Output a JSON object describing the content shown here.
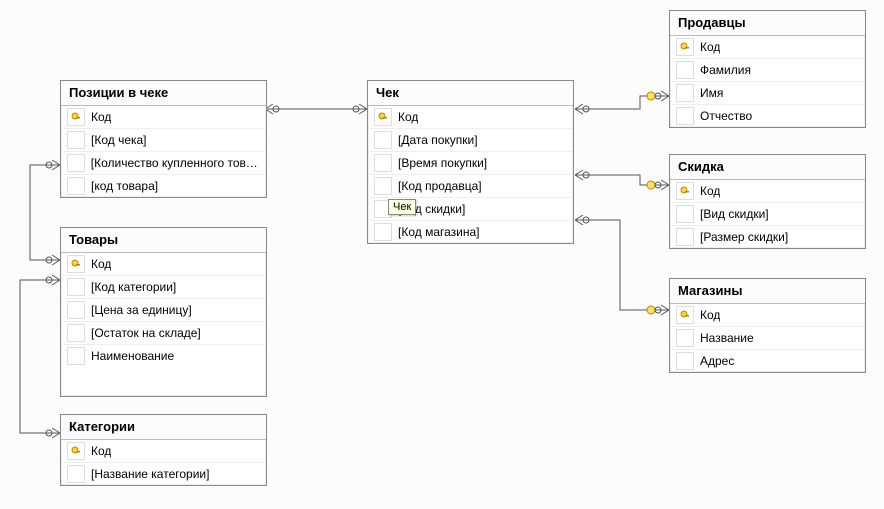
{
  "diagram_type": "database-relationship-diagram",
  "tables": {
    "positions": {
      "title": "Позиции в чеке",
      "fields": [
        {
          "name": "Код",
          "key": true
        },
        {
          "name": "[Код чека]",
          "key": false
        },
        {
          "name": "[Количество купленного това...",
          "key": false
        },
        {
          "name": "[код товара]",
          "key": false
        }
      ]
    },
    "check": {
      "title": "Чек",
      "fields": [
        {
          "name": "Код",
          "key": true
        },
        {
          "name": "[Дата покупки]",
          "key": false
        },
        {
          "name": "[Время покупки]",
          "key": false
        },
        {
          "name": "[Код продавца]",
          "key": false
        },
        {
          "name": "[Код скидки]",
          "key": false
        },
        {
          "name": "[Код магазина]",
          "key": false
        }
      ]
    },
    "goods": {
      "title": "Товары",
      "fields": [
        {
          "name": "Код",
          "key": true
        },
        {
          "name": "[Код категории]",
          "key": false
        },
        {
          "name": "[Цена за единицу]",
          "key": false
        },
        {
          "name": "[Остаток на складе]",
          "key": false
        },
        {
          "name": "Наименование",
          "key": false
        }
      ]
    },
    "categories": {
      "title": "Категории",
      "fields": [
        {
          "name": "Код",
          "key": true
        },
        {
          "name": "[Название категории]",
          "key": false
        }
      ]
    },
    "sellers": {
      "title": "Продавцы",
      "fields": [
        {
          "name": "Код",
          "key": true
        },
        {
          "name": "Фамилия",
          "key": false
        },
        {
          "name": "Имя",
          "key": false
        },
        {
          "name": "Отчество",
          "key": false
        }
      ]
    },
    "discount": {
      "title": "Скидка",
      "fields": [
        {
          "name": "Код",
          "key": true
        },
        {
          "name": "[Вид скидки]",
          "key": false
        },
        {
          "name": "[Размер скидки]",
          "key": false
        }
      ]
    },
    "stores": {
      "title": "Магазины",
      "fields": [
        {
          "name": "Код",
          "key": true
        },
        {
          "name": "Название",
          "key": false
        },
        {
          "name": "Адрес",
          "key": false
        }
      ]
    }
  },
  "tooltip": {
    "text": "Чек"
  },
  "relationships": [
    {
      "from": "positions.[Код чека]",
      "to": "check.Код",
      "type": "one-to-many"
    },
    {
      "from": "positions.[код товара]",
      "to": "goods.Код",
      "type": "one-to-many"
    },
    {
      "from": "goods.[Код категории]",
      "to": "categories.Код",
      "type": "one-to-many"
    },
    {
      "from": "check.[Код продавца]",
      "to": "sellers.Код",
      "type": "one-to-many"
    },
    {
      "from": "check.[Код скидки]",
      "to": "discount.Код",
      "type": "one-to-many"
    },
    {
      "from": "check.[Код магазина]",
      "to": "stores.Код",
      "type": "one-to-many"
    }
  ]
}
